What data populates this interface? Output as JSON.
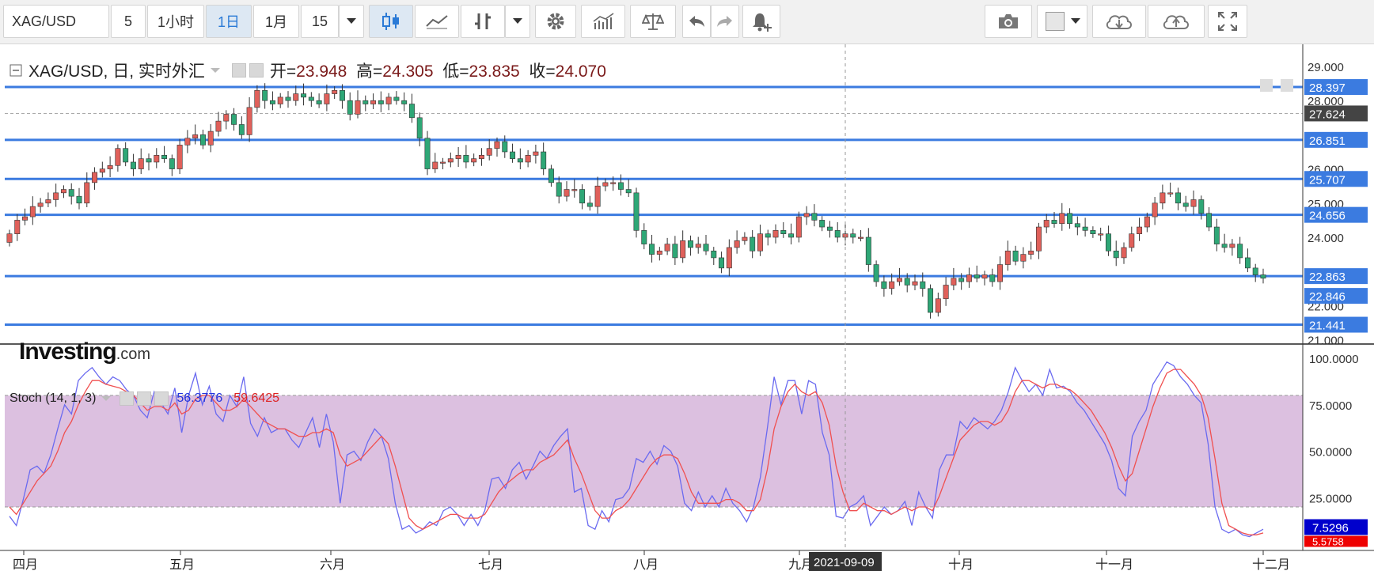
{
  "toolbar": {
    "symbol": "XAG/USD",
    "interval_5": "5",
    "interval_1h": "1小时",
    "interval_1d": "1日",
    "interval_1m": "1月",
    "interval_15": "15",
    "icons": [
      "candlestick-icon",
      "line-chart-icon",
      "bar-chart-icon",
      "settings-icon",
      "indicators-icon",
      "compare-icon",
      "undo-icon",
      "redo-icon",
      "alert-icon",
      "camera-icon",
      "color-icon",
      "cloud-download-icon",
      "cloud-upload-icon",
      "fullscreen-icon"
    ]
  },
  "legend": {
    "title": "XAG/USD, 日, 实时外汇",
    "open_label": "开=",
    "open": "23.948",
    "high_label": "高=",
    "high": "24.305",
    "low_label": "低=",
    "low": "23.835",
    "close_label": "收=",
    "close": "24.070"
  },
  "stoch_legend": {
    "name": "Stoch (14, 1, 3)",
    "k": "56.3776",
    "d": "59.6425"
  },
  "logo": {
    "main": "Investing",
    "suffix": ".com"
  },
  "colors": {
    "up": "#e0605a",
    "down": "#2ea776",
    "level": "#3b7be0",
    "k_line": "#6a6af0",
    "d_line": "#f05050",
    "band": "#dcc0e0",
    "crosshair_label": "#333333"
  },
  "crosshair": {
    "date": "2021-09-09"
  },
  "chart_data": [
    {
      "type": "candlestick",
      "title": "XAG/USD",
      "y_range": [
        21.0,
        29.5
      ],
      "y_ticks": [
        "29.000",
        "28.000",
        "26.000",
        "25.000",
        "24.000",
        "22.000",
        "21.000"
      ],
      "x_ticks": [
        "四月",
        "五月",
        "六月",
        "七月",
        "八月",
        "九月",
        "十月",
        "十一月",
        "十二月"
      ],
      "price_labels": [
        {
          "value": "28.397",
          "style": "level"
        },
        {
          "value": "27.624",
          "style": "current"
        },
        {
          "value": "26.851",
          "style": "level"
        },
        {
          "value": "25.707",
          "style": "level"
        },
        {
          "value": "24.656",
          "style": "level"
        },
        {
          "value": "22.863",
          "style": "level"
        },
        {
          "value": "22.846",
          "style": "level"
        },
        {
          "value": "21.441",
          "style": "level"
        }
      ],
      "horizontal_levels": [
        28.397,
        26.851,
        25.707,
        24.656,
        22.863,
        21.441
      ],
      "dashed_level": 27.624,
      "closes": [
        24.1,
        24.5,
        24.6,
        24.9,
        25.0,
        25.1,
        25.3,
        25.4,
        25.2,
        25.0,
        25.6,
        25.9,
        26.0,
        26.1,
        26.6,
        26.2,
        26.0,
        26.3,
        26.2,
        26.4,
        26.3,
        26.0,
        26.7,
        26.9,
        27.0,
        26.7,
        27.1,
        27.4,
        27.6,
        27.3,
        27.0,
        27.8,
        28.3,
        28.0,
        27.9,
        28.1,
        28.0,
        28.2,
        28.1,
        28.0,
        27.9,
        28.2,
        28.3,
        28.0,
        27.6,
        28.0,
        27.9,
        28.0,
        27.9,
        28.1,
        28.0,
        27.9,
        27.5,
        26.9,
        26.0,
        26.2,
        26.2,
        26.3,
        26.4,
        26.2,
        26.3,
        26.4,
        26.6,
        26.8,
        26.5,
        26.3,
        26.2,
        26.4,
        26.5,
        26.0,
        25.6,
        25.2,
        25.4,
        25.4,
        25.0,
        24.9,
        25.5,
        25.6,
        25.6,
        25.4,
        25.3,
        24.2,
        23.8,
        23.5,
        23.6,
        23.8,
        23.4,
        23.9,
        23.7,
        23.8,
        23.6,
        23.4,
        23.1,
        23.7,
        23.9,
        24.0,
        23.6,
        24.1,
        24.0,
        24.2,
        24.1,
        24.0,
        24.6,
        24.7,
        24.5,
        24.3,
        24.2,
        24.0,
        24.1,
        24.0,
        24.0,
        23.2,
        22.7,
        22.5,
        22.7,
        22.8,
        22.6,
        22.7,
        22.5,
        21.8,
        22.2,
        22.6,
        22.8,
        22.7,
        22.9,
        22.8,
        22.9,
        22.7,
        23.2,
        23.6,
        23.3,
        23.5,
        23.6,
        24.3,
        24.5,
        24.4,
        24.7,
        24.4,
        24.3,
        24.2,
        24.1,
        24.1,
        23.6,
        23.4,
        23.7,
        24.1,
        24.3,
        24.6,
        25.0,
        25.3,
        25.3,
        25.0,
        24.9,
        25.1,
        24.7,
        24.3,
        23.8,
        23.7,
        23.8,
        23.4,
        23.1,
        22.9,
        22.8
      ],
      "opens_follow_previous_close": true
    },
    {
      "type": "line",
      "title": "Stoch (14, 1, 3)",
      "y_range": [
        0,
        100
      ],
      "y_ticks": [
        "100.0000",
        "75.0000",
        "50.0000",
        "25.0000"
      ],
      "band": [
        20,
        80
      ],
      "last_values": {
        "k": "7.5296",
        "d": "5.5758"
      },
      "series": [
        {
          "name": "%K",
          "values": [
            15,
            10,
            24,
            40,
            42,
            38,
            48,
            62,
            75,
            70,
            88,
            92,
            95,
            90,
            86,
            90,
            88,
            83,
            80,
            72,
            68,
            82,
            76,
            70,
            84,
            60,
            80,
            92,
            75,
            85,
            70,
            66,
            80,
            74,
            90,
            65,
            58,
            68,
            60,
            62,
            62,
            56,
            52,
            60,
            68,
            52,
            70,
            55,
            22,
            48,
            50,
            45,
            55,
            62,
            58,
            46,
            22,
            8,
            10,
            6,
            8,
            12,
            10,
            18,
            20,
            16,
            10,
            16,
            10,
            18,
            35,
            36,
            30,
            40,
            44,
            35,
            42,
            50,
            46,
            53,
            58,
            62,
            28,
            30,
            10,
            8,
            18,
            12,
            24,
            25,
            30,
            46,
            44,
            50,
            43,
            53,
            50,
            42,
            22,
            18,
            28,
            20,
            26,
            20,
            30,
            22,
            18,
            12,
            20,
            36,
            62,
            90,
            75,
            88,
            88,
            70,
            88,
            86,
            60,
            48,
            15,
            14,
            20,
            22,
            26,
            10,
            15,
            20,
            16,
            18,
            23,
            10,
            28,
            20,
            14,
            40,
            48,
            48,
            66,
            62,
            68,
            65,
            62,
            66,
            72,
            82,
            95,
            88,
            82,
            86,
            80,
            94,
            84,
            85,
            82,
            76,
            72,
            66,
            60,
            54,
            45,
            30,
            26,
            58,
            66,
            72,
            86,
            92,
            98,
            96,
            90,
            86,
            80,
            76,
            54,
            20,
            8,
            6,
            8,
            5,
            4,
            6,
            8
          ]
        },
        {
          "name": "%D",
          "values": [
            20,
            16,
            22,
            28,
            34,
            38,
            42,
            50,
            60,
            66,
            75,
            82,
            88,
            88,
            86,
            85,
            84,
            82,
            80,
            76,
            72,
            74,
            74,
            72,
            76,
            70,
            72,
            78,
            80,
            80,
            76,
            72,
            72,
            74,
            78,
            74,
            70,
            66,
            64,
            62,
            62,
            60,
            58,
            58,
            60,
            60,
            62,
            60,
            48,
            42,
            44,
            46,
            50,
            54,
            58,
            54,
            42,
            28,
            14,
            10,
            8,
            10,
            12,
            14,
            16,
            16,
            14,
            14,
            14,
            16,
            22,
            28,
            32,
            35,
            38,
            40,
            40,
            44,
            46,
            48,
            52,
            56,
            46,
            38,
            28,
            18,
            14,
            14,
            18,
            20,
            24,
            30,
            36,
            42,
            46,
            48,
            48,
            46,
            38,
            28,
            22,
            22,
            22,
            22,
            24,
            24,
            22,
            18,
            18,
            24,
            40,
            62,
            74,
            82,
            86,
            82,
            80,
            82,
            76,
            64,
            42,
            28,
            18,
            18,
            22,
            20,
            18,
            18,
            16,
            18,
            20,
            18,
            20,
            20,
            18,
            26,
            36,
            46,
            56,
            60,
            64,
            66,
            66,
            64,
            66,
            72,
            82,
            88,
            88,
            86,
            84,
            86,
            86,
            84,
            83,
            80,
            76,
            72,
            66,
            60,
            52,
            42,
            34,
            38,
            50,
            62,
            74,
            84,
            92,
            94,
            94,
            90,
            86,
            80,
            68,
            46,
            22,
            10,
            8,
            6,
            5,
            5,
            6
          ]
        }
      ]
    }
  ]
}
